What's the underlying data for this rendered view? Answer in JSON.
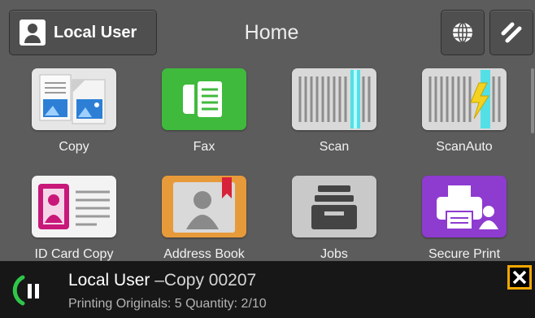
{
  "header": {
    "user_button_label": "Local User",
    "title": "Home",
    "globe_icon": "globe-icon",
    "tools_icon": "tools-icon"
  },
  "apps": [
    {
      "label": "Copy",
      "icon": "copy-icon"
    },
    {
      "label": "Fax",
      "icon": "fax-icon"
    },
    {
      "label": "Scan",
      "icon": "scan-icon"
    },
    {
      "label": "ScanAuto",
      "icon": "scan-auto-icon"
    },
    {
      "label": "ID Card Copy",
      "icon": "id-card-icon"
    },
    {
      "label": "Address Book",
      "icon": "address-book-icon"
    },
    {
      "label": "Jobs",
      "icon": "jobs-icon"
    },
    {
      "label": "Secure Print",
      "icon": "secure-print-icon"
    }
  ],
  "job_bar": {
    "user": "Local User",
    "separator": "–",
    "job_name": "Copy 00207",
    "detail": "Printing Originals: 5 Quantity: 2/10",
    "close_icon": "close-icon",
    "status_icon": "pause-icon"
  },
  "colors": {
    "background": "#5c5c5c",
    "fax_green": "#3fba3c",
    "scan_cyan": "#39e0e8",
    "secure_purple": "#8e3bd0",
    "id_magenta": "#c8187a",
    "address_orange": "#e79a3a",
    "close_border": "#f5a800",
    "status_green": "#2fc64a"
  }
}
